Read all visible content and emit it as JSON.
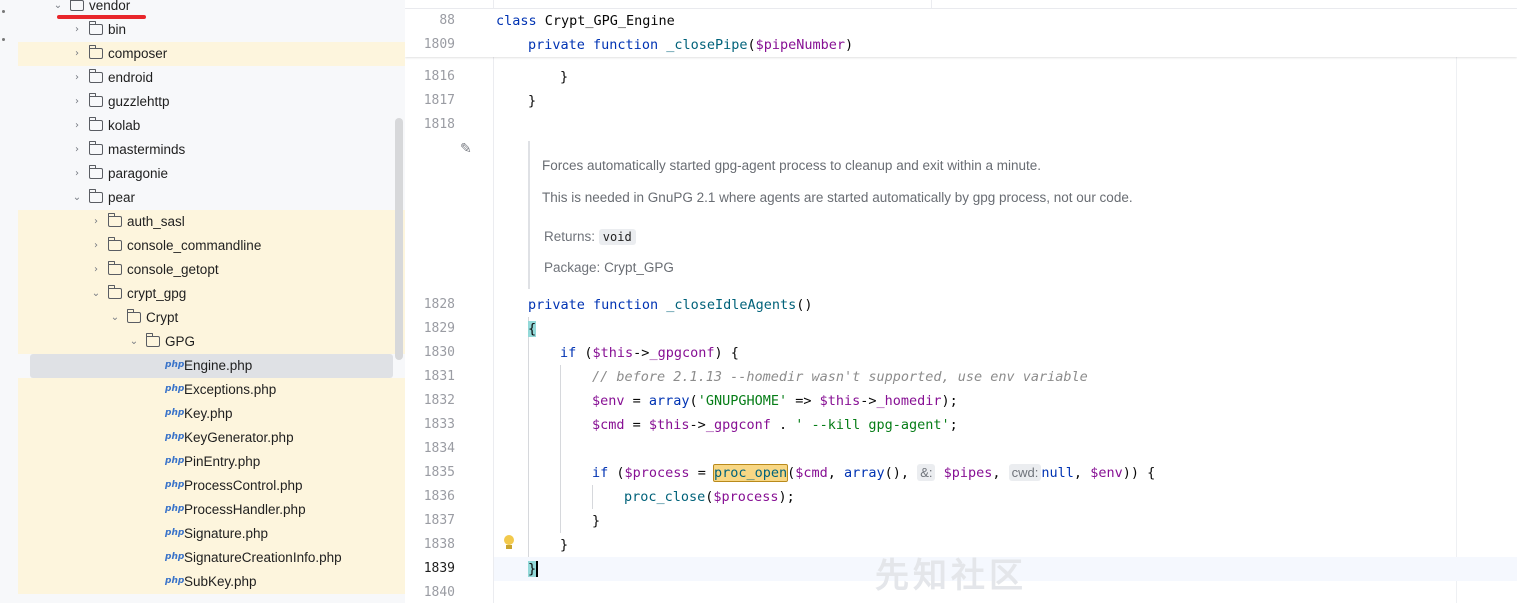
{
  "project_tree": {
    "items": [
      {
        "label": "vendor",
        "type": "folder",
        "expanded": true,
        "depth": 0
      },
      {
        "label": "bin",
        "type": "folder",
        "expanded": false,
        "depth": 1
      },
      {
        "label": "composer",
        "type": "folder",
        "expanded": false,
        "depth": 1
      },
      {
        "label": "endroid",
        "type": "folder",
        "expanded": false,
        "depth": 1
      },
      {
        "label": "guzzlehttp",
        "type": "folder",
        "expanded": false,
        "depth": 1
      },
      {
        "label": "kolab",
        "type": "folder",
        "expanded": false,
        "depth": 1
      },
      {
        "label": "masterminds",
        "type": "folder",
        "expanded": false,
        "depth": 1
      },
      {
        "label": "paragonie",
        "type": "folder",
        "expanded": false,
        "depth": 1
      },
      {
        "label": "pear",
        "type": "folder",
        "expanded": true,
        "depth": 1
      },
      {
        "label": "auth_sasl",
        "type": "folder",
        "expanded": false,
        "depth": 2
      },
      {
        "label": "console_commandline",
        "type": "folder",
        "expanded": false,
        "depth": 2
      },
      {
        "label": "console_getopt",
        "type": "folder",
        "expanded": false,
        "depth": 2
      },
      {
        "label": "crypt_gpg",
        "type": "folder",
        "expanded": true,
        "depth": 2
      },
      {
        "label": "Crypt",
        "type": "folder",
        "expanded": true,
        "depth": 3
      },
      {
        "label": "GPG",
        "type": "folder",
        "expanded": true,
        "depth": 4
      },
      {
        "label": "Engine.php",
        "type": "php",
        "depth": 5,
        "selected": true
      },
      {
        "label": "Exceptions.php",
        "type": "php",
        "depth": 5
      },
      {
        "label": "Key.php",
        "type": "php",
        "depth": 5
      },
      {
        "label": "KeyGenerator.php",
        "type": "php",
        "depth": 5
      },
      {
        "label": "PinEntry.php",
        "type": "php",
        "depth": 5
      },
      {
        "label": "ProcessControl.php",
        "type": "php",
        "depth": 5
      },
      {
        "label": "ProcessHandler.php",
        "type": "php",
        "depth": 5
      },
      {
        "label": "Signature.php",
        "type": "php",
        "depth": 5
      },
      {
        "label": "SignatureCreationInfo.php",
        "type": "php",
        "depth": 5
      },
      {
        "label": "SubKey.php",
        "type": "php",
        "depth": 5
      }
    ],
    "php_badge": "php",
    "colors": {
      "highlight": "#fdf5dd",
      "selected": "#dfe1e5",
      "annotation_underline": "#e8262b"
    }
  },
  "editor": {
    "sticky": {
      "line1": {
        "num": "88",
        "kw": "class",
        "text": " Crypt_GPG_Engine"
      },
      "line2": {
        "num": "1809",
        "kw1": "private",
        "kw2": "function",
        "fn": "_closePipe",
        "args_open": "(",
        "var": "$pipeNumber",
        "args_close": ")"
      }
    },
    "lines": {
      "l1816": {
        "num": "1816",
        "text": "}"
      },
      "l1817": {
        "num": "1817",
        "text": "}"
      },
      "l1818": {
        "num": "1818",
        "text": ""
      },
      "l1828": {
        "num": "1828",
        "kw1": "private",
        "kw2": "function",
        "fn": "_closeIdleAgents",
        "rest": "()"
      },
      "l1829": {
        "num": "1829",
        "text": "{"
      },
      "l1830": {
        "num": "1830",
        "kw": "if",
        "p1": " (",
        "var": "$this",
        "arrow": "->",
        "prop": "_gpgconf",
        "p2": ") {"
      },
      "l1831": {
        "num": "1831",
        "comment": "// before 2.1.13 --homedir wasn't supported, use env variable"
      },
      "l1832": {
        "num": "1832",
        "var": "$env",
        "eq": " = ",
        "kw": "array",
        "p1": "(",
        "str": "'GNUPGHOME'",
        "op": " => ",
        "var2": "$this",
        "arrow": "->",
        "prop": "_homedir",
        "p2": ");"
      },
      "l1833": {
        "num": "1833",
        "var": "$cmd",
        "eq": " = ",
        "var2": "$this",
        "arrow": "->",
        "prop": "_gpgconf",
        "dot": " . ",
        "str": "' --kill gpg-agent'",
        "end": ";"
      },
      "l1834": {
        "num": "1834",
        "text": ""
      },
      "l1835": {
        "num": "1835",
        "kw": "if",
        "p1": " (",
        "var": "$process",
        "eq": " = ",
        "fn": "proc_open",
        "p2": "(",
        "var2": "$cmd",
        "c1": ", ",
        "kw2": "array",
        "p3": "(), ",
        "hint1": "&:",
        "var3": "$pipes",
        "c2": ", ",
        "hint2": "cwd:",
        "kw3": "null",
        "c3": ", ",
        "var4": "$env",
        "p4": ")) {"
      },
      "l1836": {
        "num": "1836",
        "fn": "proc_close",
        "p1": "(",
        "var": "$process",
        "p2": ");"
      },
      "l1837": {
        "num": "1837",
        "text": "}"
      },
      "l1838": {
        "num": "1838",
        "text": "}"
      },
      "l1839": {
        "num": "1839",
        "text": "}"
      },
      "l1840": {
        "num": "1840",
        "text": ""
      }
    },
    "doc": {
      "summary": "Forces automatically started gpg-agent process to cleanup and exit within a minute.",
      "detail": "This is needed in GnuPG 2.1 where agents are started automatically by gpg process, not our code.",
      "returns_label": "Returns:",
      "returns_value": "void",
      "package_label": "Package:",
      "package_value": "Crypt_GPG"
    },
    "icons": {
      "edit": "pencil-icon",
      "intention": "lightbulb-icon"
    }
  },
  "watermark": "先知社区"
}
